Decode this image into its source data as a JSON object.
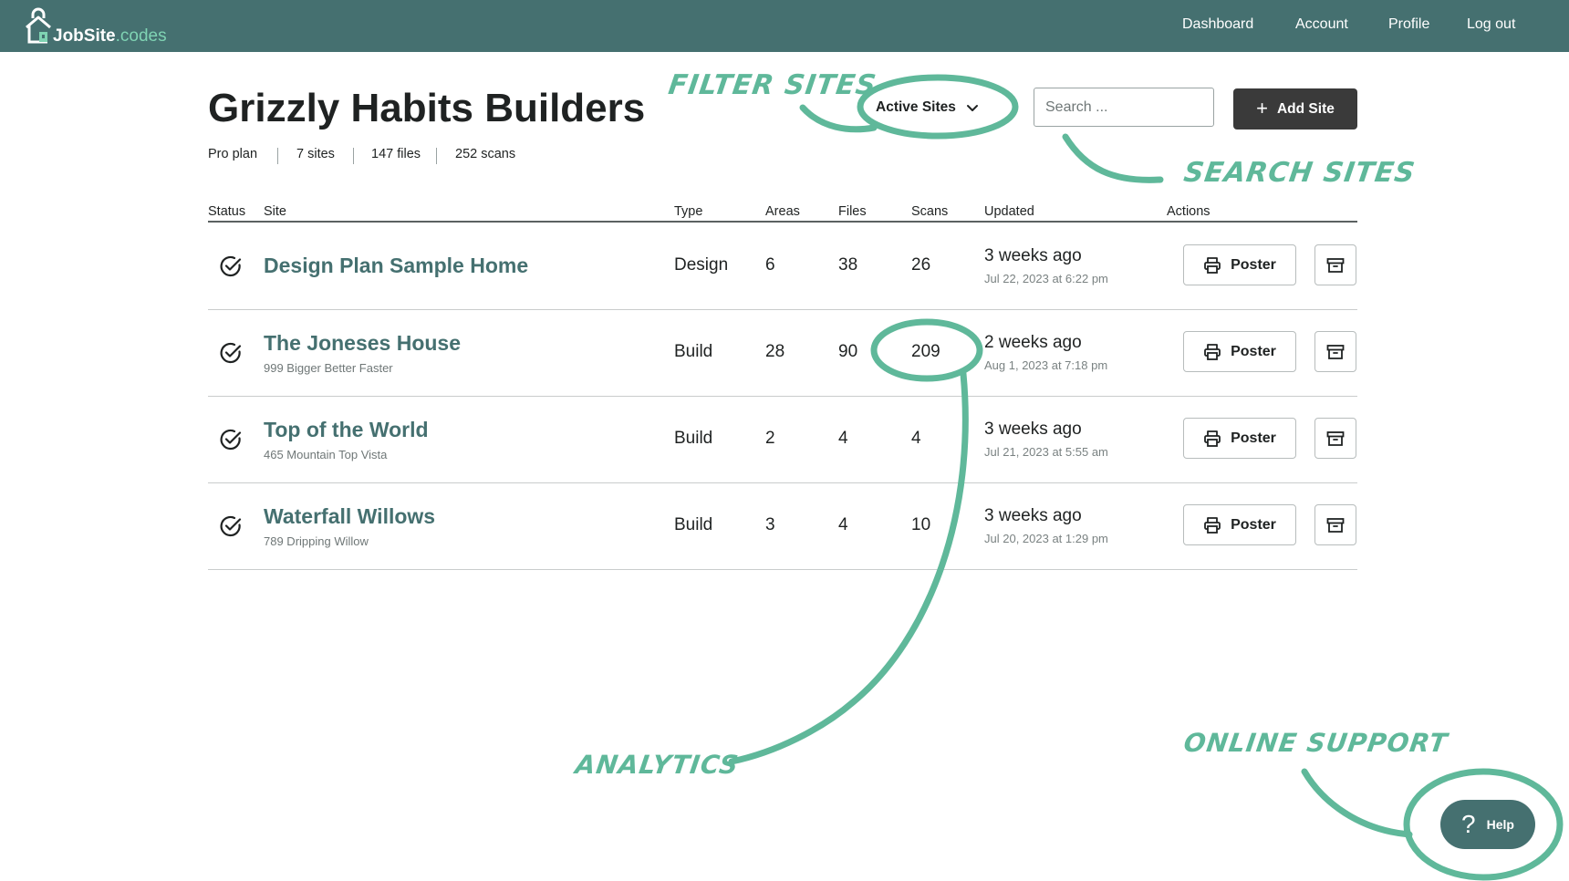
{
  "app": {
    "logo_primary": "JobSite",
    "logo_secondary": ".codes"
  },
  "nav": {
    "items": [
      "Dashboard",
      "Account",
      "Profile",
      "Log out"
    ]
  },
  "header": {
    "title": "Grizzly Habits Builders",
    "stats": [
      "Pro plan",
      "7 sites",
      "147 files",
      "252 scans"
    ],
    "filter_label": "Active Sites",
    "search_placeholder": "Search ...",
    "add_button_label": "Add Site"
  },
  "table": {
    "columns": [
      "Status",
      "Site",
      "Type",
      "Areas",
      "Files",
      "Scans",
      "Updated",
      "Actions"
    ],
    "rows": [
      {
        "name": "Design Plan Sample Home",
        "address": "",
        "type": "Design",
        "areas": "6",
        "files": "38",
        "scans": "26",
        "updated_relative": "3 weeks ago",
        "updated_absolute": "Jul 22, 2023 at 6:22 pm",
        "action_label": "Poster"
      },
      {
        "name": "The Joneses House",
        "address": "999 Bigger Better Faster",
        "type": "Build",
        "areas": "28",
        "files": "90",
        "scans": "209",
        "updated_relative": "2 weeks ago",
        "updated_absolute": "Aug 1, 2023 at 7:18 pm",
        "action_label": "Poster"
      },
      {
        "name": "Top of the World",
        "address": "465 Mountain Top Vista",
        "type": "Build",
        "areas": "2",
        "files": "4",
        "scans": "4",
        "updated_relative": "3 weeks ago",
        "updated_absolute": "Jul 21, 2023 at 5:55 am",
        "action_label": "Poster"
      },
      {
        "name": "Waterfall Willows",
        "address": "789 Dripping Willow",
        "type": "Build",
        "areas": "3",
        "files": "4",
        "scans": "10",
        "updated_relative": "3 weeks ago",
        "updated_absolute": "Jul 20, 2023 at 1:29 pm",
        "action_label": "Poster"
      }
    ]
  },
  "help": {
    "label": "Help"
  },
  "annotations": {
    "filter_sites": "FILTER SITES",
    "search_sites": "SEARCH SITES",
    "analytics": "ANALYTICS",
    "online_support": "ONLINE SUPPORT",
    "color": "#5fb89a"
  },
  "colors": {
    "nav_bg": "#457070",
    "accent": "#457070",
    "annotation": "#5fb89a",
    "dark_button": "#3a3a3a"
  }
}
